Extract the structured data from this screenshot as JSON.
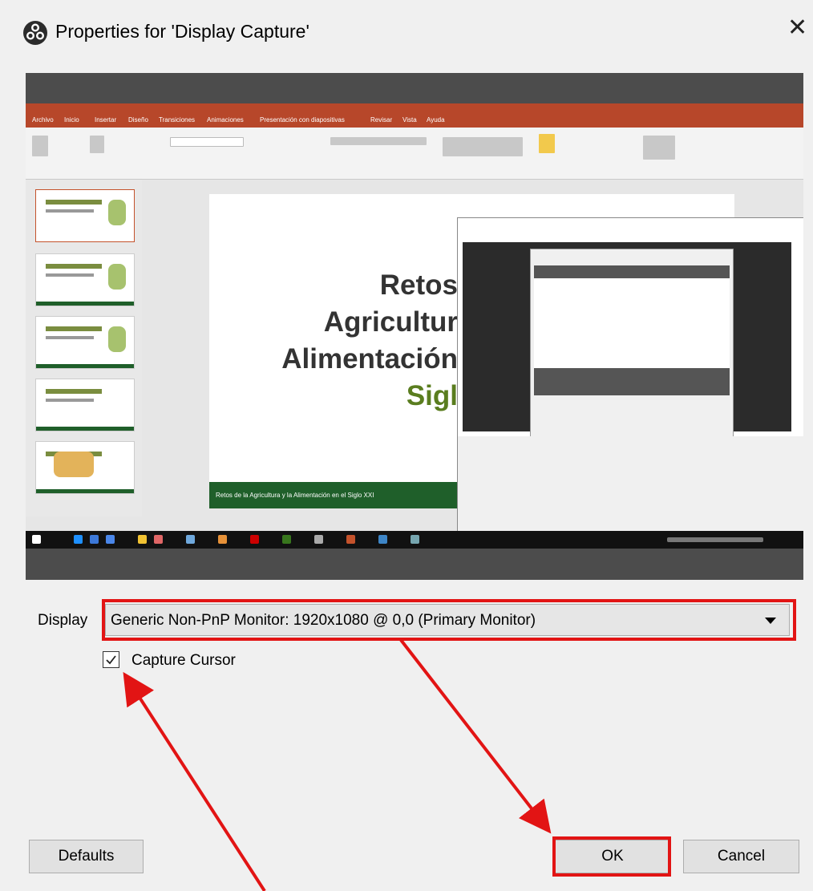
{
  "window": {
    "title": "Properties for 'Display Capture'",
    "close_glyph": "✕",
    "app_icon": "obs-icon"
  },
  "preview": {
    "ribbon_tabs": [
      "Archivo",
      "Inicio",
      "Insertar",
      "Diseño",
      "Transiciones",
      "Animaciones",
      "Presentación con diapositivas",
      "Revisar",
      "Vista",
      "Ayuda"
    ],
    "slide": {
      "title_lines": [
        "Retos",
        "Agricultur",
        "Alimentación",
        "Sigl"
      ],
      "footer": "Retos de la Agricultura y la Alimentación en el Siglo XXI"
    }
  },
  "form": {
    "display_label": "Display",
    "display_value": "Generic Non-PnP Monitor: 1920x1080 @ 0,0 (Primary Monitor)",
    "capture_cursor_label": "Capture Cursor",
    "capture_cursor_checked": true
  },
  "buttons": {
    "defaults": "Defaults",
    "ok": "OK",
    "cancel": "Cancel"
  },
  "annotations": {
    "highlight_color": "#e21414"
  }
}
